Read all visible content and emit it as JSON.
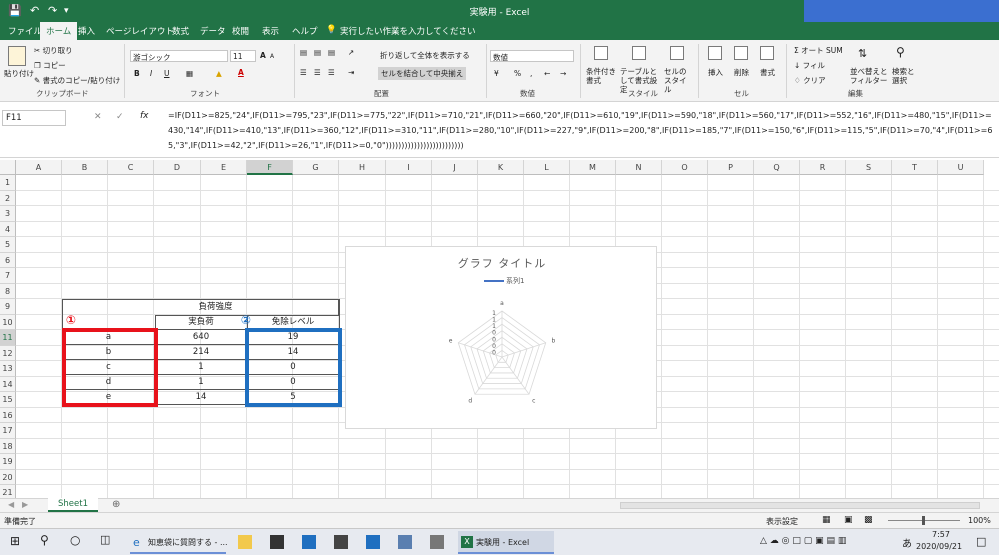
{
  "window": {
    "title": "実験用 - Excel",
    "quick_access": [
      "save-icon",
      "undo-icon",
      "redo-icon",
      "customize-icon"
    ]
  },
  "ribbon_tabs": [
    "ファイル",
    "ホーム",
    "挿入",
    "ページレイアウト",
    "数式",
    "データ",
    "校閲",
    "表示",
    "ヘルプ"
  ],
  "ribbon_tabs_active": "ホーム",
  "tell_me": "実行したい作業を入力してください",
  "ribbon": {
    "clipboard": {
      "paste": "貼り付け",
      "cut": "切り取り",
      "copy": "コピー",
      "format_painter": "書式のコピー/貼り付け",
      "group": "クリップボード"
    },
    "font": {
      "name": "游ゴシック",
      "size": "11",
      "group": "フォント",
      "bold": "B",
      "italic": "I",
      "underline": "U",
      "grow": "A",
      "shrink": "A"
    },
    "alignment": {
      "wrap": "折り返して全体を表示する",
      "merge": "セルを結合して中央揃え",
      "group": "配置"
    },
    "number": {
      "format": "数値",
      "group": "数値",
      "percent": "%",
      "comma": ","
    },
    "styles": {
      "conditional": "条件付き書式",
      "table": "テーブルとして書式設定",
      "cell_styles": "セルのスタイル",
      "group": "スタイル"
    },
    "cells": {
      "insert": "挿入",
      "delete": "削除",
      "format": "書式",
      "group": "セル"
    },
    "editing": {
      "autosum": "オート SUM",
      "fill": "フィル",
      "clear": "クリア",
      "sort": "並べ替えとフィルター",
      "find": "検索と選択",
      "group": "編集"
    }
  },
  "formula_bar": {
    "name_box": "F11",
    "fx": "fx",
    "formula": "=IF(D11>=825,\"24\",IF(D11>=795,\"23\",IF(D11>=775,\"22\",IF(D11>=710,\"21\",IF(D11>=660,\"20\",IF(D11>=610,\"19\",IF(D11>=590,\"18\",IF(D11>=560,\"17\",IF(D11>=552,\"16\",IF(D11>=480,\"15\",IF(D11>=430,\"14\",IF(D11>=410,\"13\",IF(D11>=360,\"12\",IF(D11>=310,\"11\",IF(D11>=280,\"10\",IF(D11>=227,\"9\",IF(D11>=200,\"8\",IF(D11>=185,\"7\",IF(D11>=150,\"6\",IF(D11>=115,\"5\",IF(D11>=70,\"4\",IF(D11>=65,\"3\",IF(D11>=42,\"2\",IF(D11>=26,\"1\",IF(D11>=0,\"0\")))))))))))))))))))))))))"
  },
  "columns": [
    "A",
    "B",
    "C",
    "D",
    "E",
    "F",
    "G",
    "H",
    "I",
    "J",
    "K",
    "L",
    "M",
    "N",
    "O",
    "P",
    "Q",
    "R",
    "S",
    "T",
    "U"
  ],
  "rows": [
    "1",
    "2",
    "3",
    "4",
    "5",
    "6",
    "7",
    "8",
    "9",
    "10",
    "11",
    "12",
    "13",
    "14",
    "15",
    "16",
    "17",
    "18",
    "19",
    "20",
    "21"
  ],
  "table": {
    "header_main": "負荷強度",
    "header_load": "実負荷",
    "header_level": "免除レベル",
    "marker_1": "①",
    "marker_2": "②",
    "rows": [
      {
        "name": "a",
        "load": "640",
        "level": "19"
      },
      {
        "name": "b",
        "load": "214",
        "level": "14"
      },
      {
        "name": "c",
        "load": "1",
        "level": "0"
      },
      {
        "name": "d",
        "load": "1",
        "level": "0"
      },
      {
        "name": "e",
        "load": "14",
        "level": "5"
      }
    ]
  },
  "chart": {
    "title": "グラフ タイトル",
    "legend": "系列1",
    "axes": [
      "a",
      "b",
      "c",
      "d",
      "e"
    ],
    "tick_labels": [
      "1",
      "1",
      "1",
      "0",
      "0",
      "0",
      "0"
    ]
  },
  "colors": {
    "excel_green": "#217346",
    "highlight_red": "#e8121b",
    "highlight_blue": "#1f6fc0",
    "arrow_blue": "#1f6fc0",
    "series_blue": "#4472c4"
  },
  "sheet_tab": "Sheet1",
  "status": {
    "ready": "準備完了",
    "display_settings": "表示設定",
    "zoom": "100%"
  },
  "taskbar": {
    "app_chiebukuro": "知恵袋に質問する - ...",
    "app_excel": "実験用 - Excel",
    "ime": "あ",
    "time": "7:57",
    "date": "2020/09/21"
  }
}
